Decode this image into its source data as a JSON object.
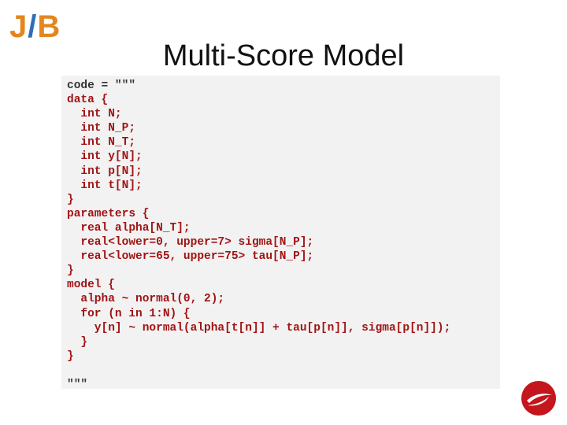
{
  "logo": {
    "j": "J",
    "slash": "/",
    "b": "B"
  },
  "slide": {
    "title": "Multi-Score Model"
  },
  "colors": {
    "logo_orange": "#e3861f",
    "logo_blue": "#2f6fb5",
    "code_text": "#333333",
    "code_keyword": "#a01414",
    "code_background": "#f2f2f2",
    "badge_red": "#c4161c"
  },
  "code": {
    "lines": [
      {
        "text": "code = \"\"\"",
        "kind": "plain"
      },
      {
        "text": "data {",
        "kind": "keyword"
      },
      {
        "text": "  int N;",
        "kind": "keyword"
      },
      {
        "text": "  int N_P;",
        "kind": "keyword"
      },
      {
        "text": "  int N_T;",
        "kind": "keyword"
      },
      {
        "text": "  int y[N];",
        "kind": "keyword"
      },
      {
        "text": "  int p[N];",
        "kind": "keyword"
      },
      {
        "text": "  int t[N];",
        "kind": "keyword"
      },
      {
        "text": "}",
        "kind": "keyword"
      },
      {
        "text": "parameters {",
        "kind": "keyword"
      },
      {
        "text": "  real alpha[N_T];",
        "kind": "keyword"
      },
      {
        "text": "  real<lower=0, upper=7> sigma[N_P];",
        "kind": "keyword"
      },
      {
        "text": "  real<lower=65, upper=75> tau[N_P];",
        "kind": "keyword"
      },
      {
        "text": "}",
        "kind": "keyword"
      },
      {
        "text": "model {",
        "kind": "keyword"
      },
      {
        "text": "  alpha ~ normal(0, 2);",
        "kind": "keyword"
      },
      {
        "text": "  for (n in 1:N) {",
        "kind": "keyword"
      },
      {
        "text": "    y[n] ~ normal(alpha[t[n]] + tau[p[n]], sigma[p[n]]);",
        "kind": "keyword"
      },
      {
        "text": "  }",
        "kind": "keyword"
      },
      {
        "text": "}",
        "kind": "keyword"
      },
      {
        "text": "",
        "kind": "plain"
      },
      {
        "text": "\"\"\"",
        "kind": "plain"
      }
    ]
  },
  "badge": {
    "icon": "swoosh-logo-icon"
  }
}
